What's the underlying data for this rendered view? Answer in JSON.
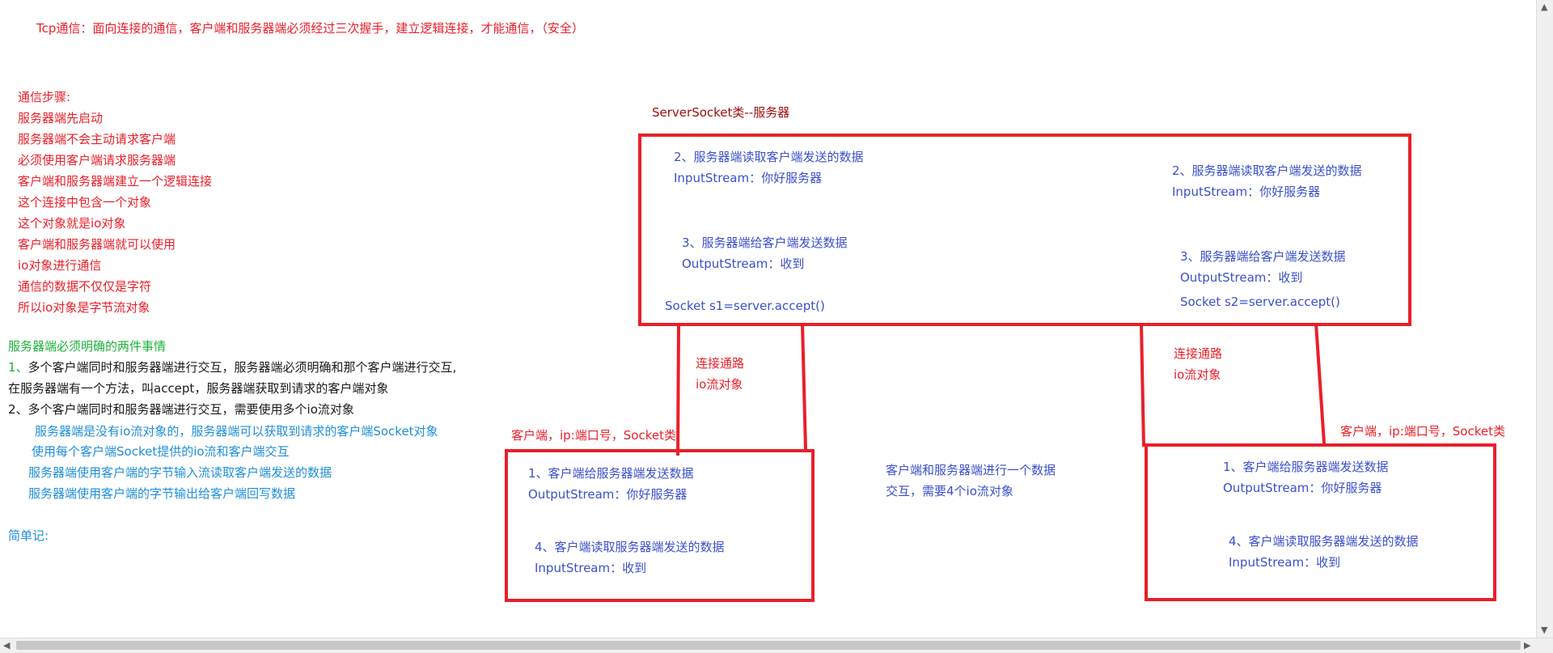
{
  "header": {
    "title": "Tcp通信：面向连接的通信，客户端和服务器端必须经过三次握手，建立逻辑连接，才能通信，（安全）"
  },
  "steps": {
    "heading": "通信步骤:",
    "lines": [
      "服务器端先启动",
      "服务器端不会主动请求客户端",
      "必须使用客户端请求服务器端",
      "客户端和服务器端建立一个逻辑连接",
      "这个连接中包含一个对象",
      "这个对象就是io对象",
      "客户端和服务器端就可以使用",
      "io对象进行通信",
      "通信的数据不仅仅是字符",
      "所以io对象是字节流对象"
    ]
  },
  "server_notes": {
    "heading": "服务器端必须明确的两件事情",
    "point1_num": "1、",
    "point1": "多个客户端同时和服务器端进行交互，服务器端必须明确和那个客户端进行交互,",
    "point1b": "在服务器端有一个方法，叫accept，服务器端获取到请求的客户端对象",
    "point2": "2、多个客户端同时和服务器端进行交互，需要使用多个io流对象",
    "sub": [
      "服务器端是没有io流对象的，服务器端可以获取到请求的客户端Socket对象",
      "使用每个客户端Socket提供的io流和客户端交互",
      "服务器端使用客户端的字节输入流读取客户端发送的数据",
      "服务器端使用客户端的字节输出给客户端回写数据"
    ],
    "summary": "简单记:"
  },
  "server": {
    "label": "ServerSocket类--服务器",
    "left": {
      "read_title": "2、服务器端读取客户端发送的数据",
      "read_stream": "InputStream：你好服务器",
      "send_title": "3、服务器端给客户端发送数据",
      "send_stream": "OutputStream：收到",
      "socket": "Socket s1=server.accept()"
    },
    "right": {
      "read_title": "2、服务器端读取客户端发送的数据",
      "read_stream": "InputStream：你好服务器",
      "send_title": "3、服务器端给客户端发送数据",
      "send_stream": "OutputStream：收到",
      "socket": "Socket s2=server.accept()"
    }
  },
  "connections": {
    "left": {
      "line1": "连接通路",
      "line2": "io流对象"
    },
    "right": {
      "line1": "连接通路",
      "line2": "io流对象"
    }
  },
  "clients": {
    "left": {
      "label": "客户端，ip:端口号，Socket类",
      "send_title": "1、客户端给服务器端发送数据",
      "send_stream": "OutputStream：你好服务器",
      "read_title": "4、客户端读取服务器端发送的数据",
      "read_stream": "InputStream：收到"
    },
    "right": {
      "label": "客户端，ip:端口号，Socket类",
      "send_title": "1、客户端给服务器端发送数据",
      "send_stream": "OutputStream：你好服务器",
      "read_title": "4、客户端读取服务器端发送的数据",
      "read_stream": "InputStream：收到"
    }
  },
  "middle_note": {
    "line1": "客户端和服务器端进行一个数据",
    "line2": "交互，需要4个io流对象"
  },
  "colors": {
    "red": "#e8202a",
    "blue": "#3b50c8",
    "green": "#1db23c",
    "cyan": "#1f8fd6"
  }
}
